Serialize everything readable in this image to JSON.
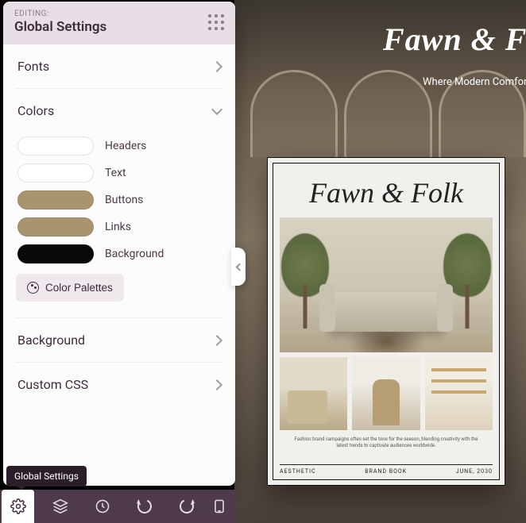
{
  "panel": {
    "eyebrow": "EDITING:",
    "title": "Global Settings",
    "sections": {
      "fonts": {
        "label": "Fonts",
        "open": false
      },
      "colors": {
        "label": "Colors",
        "open": true,
        "items": [
          {
            "label": "Headers",
            "value": "#ffffff"
          },
          {
            "label": "Text",
            "value": "#ffffff"
          },
          {
            "label": "Buttons",
            "value": "#a8956f"
          },
          {
            "label": "Links",
            "value": "#a8956f"
          },
          {
            "label": "Background",
            "value": "#0a0a0a"
          }
        ],
        "palettes_button_label": "Color Palettes"
      },
      "background": {
        "label": "Background",
        "open": false
      },
      "custom_css": {
        "label": "Custom CSS",
        "open": false
      }
    }
  },
  "tooltip": {
    "text": "Global Settings"
  },
  "toolbar": {
    "items": [
      {
        "name": "global-settings",
        "icon": "gear-icon",
        "active": true
      },
      {
        "name": "layers",
        "icon": "layers-icon",
        "active": false
      },
      {
        "name": "history",
        "icon": "history-icon",
        "active": false
      },
      {
        "name": "undo",
        "icon": "undo-icon",
        "active": false
      },
      {
        "name": "redo",
        "icon": "redo-icon",
        "active": false
      },
      {
        "name": "device-preview",
        "icon": "device-icon",
        "active": false
      }
    ]
  },
  "canvas": {
    "hero_title": "Fawn & Folk",
    "hero_subtitle": "Where Modern Comfort Meets Timeless Design",
    "card": {
      "title": "Fawn & Folk",
      "caption": "Fashion brand campaigns often set the tone for the season, blending creativity with the latest trends to captivate audiences worldwide.",
      "footer_left": "AESTHETIC",
      "footer_center": "BRAND BOOK",
      "footer_right": "JUNE, 2030"
    }
  }
}
